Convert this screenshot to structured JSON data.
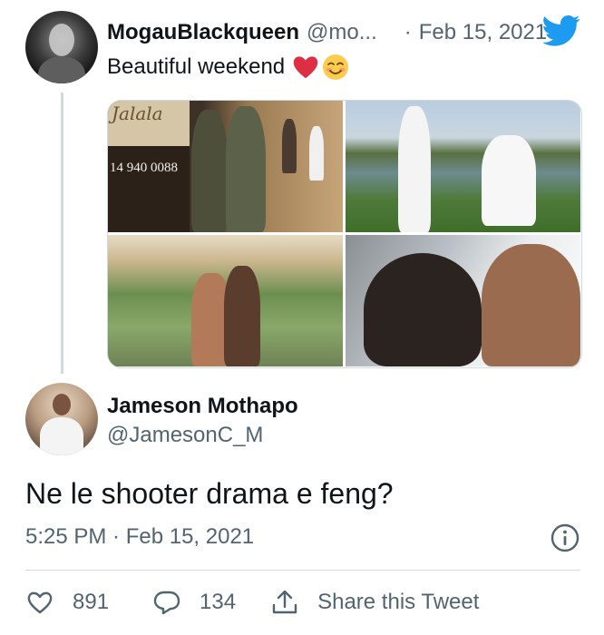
{
  "parent_tweet": {
    "name": "MogauBlackqueen",
    "handle": "@mo...",
    "separator": "·",
    "date": "Feb 15, 2021",
    "text": "Beautiful weekend",
    "emojis": [
      "red-heart-emoji",
      "smiling-face-emoji"
    ],
    "photos": [
      {
        "sign_logo": "Jalala",
        "sign_phone": "14 940 0088"
      },
      {},
      {},
      {}
    ]
  },
  "reply_tweet": {
    "name": "Jameson Mothapo",
    "handle": "@JamesonC_M",
    "text": "Ne le shooter drama e feng?",
    "timestamp": "5:25 PM · Feb 15, 2021"
  },
  "actions": {
    "likes": "891",
    "replies": "134",
    "share_label": "Share this Tweet"
  },
  "colors": {
    "twitter_blue": "#1d9bf0",
    "text_primary": "#0f1419",
    "text_secondary": "#536471",
    "border": "#cfd9de",
    "heart_red": "#e0245e"
  }
}
